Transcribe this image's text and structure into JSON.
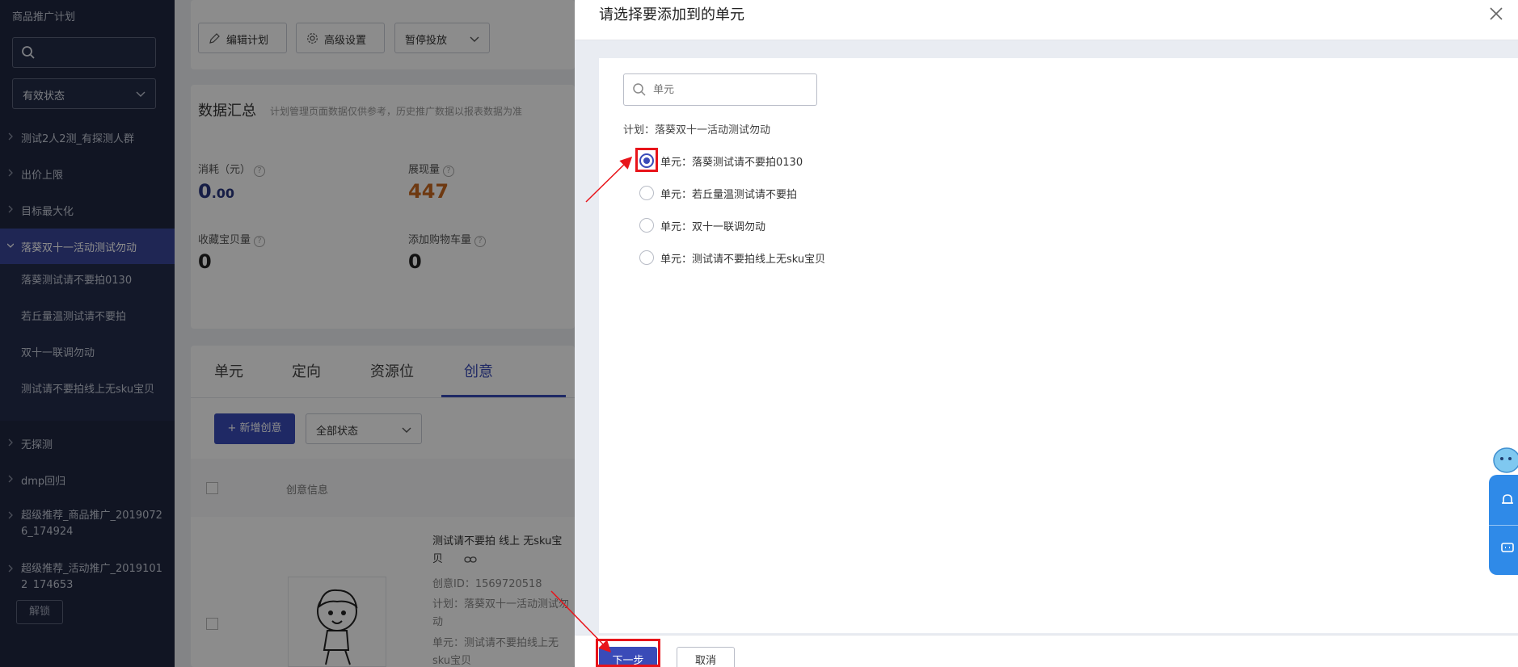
{
  "sidebar": {
    "title": "商品推广计划",
    "search_placeholder": "",
    "status_select": "有效状态",
    "items": [
      {
        "label": "测试2人2测_有探测人群"
      },
      {
        "label": "出价上限"
      },
      {
        "label": "目标最大化"
      },
      {
        "label": "落葵双十一活动测试勿动"
      },
      {
        "label": "无探测"
      },
      {
        "label": "dmp回归"
      },
      {
        "label": "超级推荐_商品推广_20190726_174924"
      },
      {
        "label": "超级推荐_活动推广_20191012_174653"
      }
    ],
    "sub_items": [
      {
        "label": "落葵测试请不要拍0130"
      },
      {
        "label": "若丘量温测试请不要拍"
      },
      {
        "label": "双十一联调勿动"
      },
      {
        "label": "测试请不要拍线上无sku宝贝"
      }
    ],
    "unlock_label": "解锁"
  },
  "main": {
    "toolbar": {
      "edit_label": "编辑计划",
      "advanced_label": "高级设置",
      "pause_label": "暂停投放"
    },
    "summary": {
      "title": "数据汇总",
      "note": "计划管理页面数据仅供参考，历史推广数据以报表数据为准",
      "stats": [
        {
          "label": "消耗（元）",
          "value_main": "0",
          "value_dec": ".00"
        },
        {
          "label": "展现量",
          "value": "447"
        },
        {
          "label": "收藏宝贝量",
          "value": "0"
        },
        {
          "label": "添加购物车量",
          "value": "0"
        }
      ]
    },
    "tabs": [
      "单元",
      "定向",
      "资源位",
      "创意"
    ],
    "new_creative_label": "+ 新增创意",
    "status_filter": "全部状态",
    "table_header": "创意信息",
    "creative": {
      "title": "测试请不要拍 线上 无sku宝贝",
      "id_line": "创意ID：1569720518",
      "plan_line": "计划：落葵双十一活动测试勿动",
      "unit_line": "单元：测试请不要拍线上无sku宝贝"
    }
  },
  "drawer": {
    "title": "请选择要添加到的单元",
    "search_placeholder": "单元",
    "plan_line": "计划：落葵双十一活动测试勿动",
    "options": [
      {
        "label": "单元：落葵测试请不要拍0130",
        "checked": true
      },
      {
        "label": "单元：若丘量温测试请不要拍",
        "checked": false
      },
      {
        "label": "单元：双十一联调勿动",
        "checked": false
      },
      {
        "label": "单元：测试请不要拍线上无sku宝贝",
        "checked": false
      }
    ],
    "next_label": "下一步",
    "cancel_label": "取消"
  },
  "colors": {
    "sidebar_bg": "#1f2741",
    "accent": "#3a4bb8",
    "highlight": "#e8141a",
    "impressions": "#c9691f"
  }
}
